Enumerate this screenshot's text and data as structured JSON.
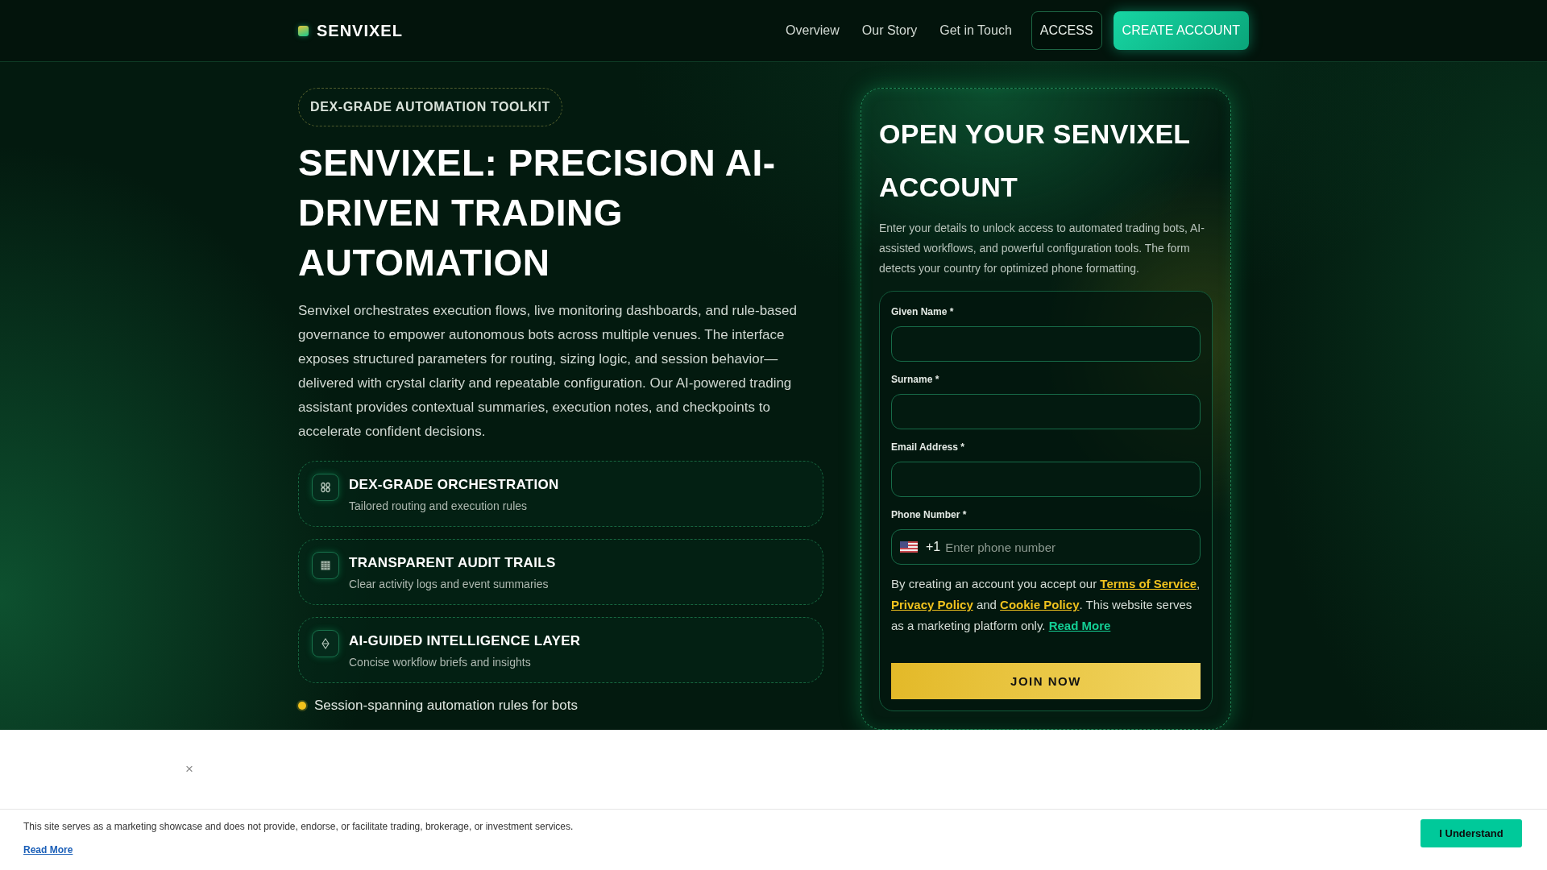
{
  "header": {
    "logo": "SENVIXEL",
    "nav": [
      {
        "label": "Overview",
        "kind": "link"
      },
      {
        "label": "Our Story",
        "kind": "link"
      },
      {
        "label": "Get in Touch",
        "kind": "link"
      },
      {
        "label": "ACCESS",
        "kind": "outline_button"
      },
      {
        "label": "CREATE ACCOUNT",
        "kind": "primary_button"
      }
    ]
  },
  "hero": {
    "badge": "DEX-GRADE AUTOMATION TOOLKIT",
    "title": "SENVIXEL: PRECISION AI-DRIVEN TRADING AUTOMATION",
    "description": "Senvixel orchestrates execution flows, live monitoring dashboards, and rule-based governance to empower autonomous bots across multiple venues. The interface exposes structured parameters for routing, sizing logic, and session behavior—delivered with crystal clarity and repeatable configuration. Our AI-powered trading assistant provides contextual summaries, execution notes, and checkpoints to accelerate confident decisions.",
    "features": [
      {
        "title": "DEX-GRADE ORCHESTRATION",
        "subtitle": "Tailored routing and execution rules"
      },
      {
        "title": "TRANSPARENT AUDIT TRAILS",
        "subtitle": "Clear activity logs and event summaries"
      },
      {
        "title": "AI-GUIDED INTELLIGENCE LAYER",
        "subtitle": "Concise workflow briefs and insights"
      }
    ],
    "highlight": "Session-spanning automation rules for bots"
  },
  "signup": {
    "title": "OPEN YOUR SENVIXEL ACCOUNT",
    "description": "Enter your details to unlock access to automated trading bots, AI-assisted workflows, and powerful configuration tools. The form detects your country for optimized phone formatting.",
    "fields": [
      {
        "label": "Given Name *",
        "kind": "text"
      },
      {
        "label": "Surname *",
        "kind": "text"
      },
      {
        "label": "Email Address *",
        "kind": "text"
      },
      {
        "label": "Phone Number *",
        "kind": "phone",
        "dial_code": "+1",
        "placeholder": "Enter phone number"
      }
    ],
    "consent": [
      {
        "kind": "text",
        "text": "By creating an account you accept our "
      },
      {
        "kind": "link",
        "text": "Terms of Service"
      },
      {
        "kind": "text",
        "text": ", "
      },
      {
        "kind": "link",
        "text": "Privacy Policy"
      },
      {
        "kind": "text",
        "text": " and "
      },
      {
        "kind": "link",
        "text": "Cookie Policy"
      },
      {
        "kind": "text",
        "text": ". This website serves as a marketing platform only. "
      },
      {
        "kind": "accent_link",
        "text": "Read More"
      }
    ],
    "submit": "JOIN NOW"
  },
  "overlay": {
    "close": "×"
  },
  "cookie_banner": {
    "text": "This site serves as a marketing showcase and does not provide, endorse, or facilitate trading, brokerage, or investment services.",
    "link": "Read More",
    "button": "I Understand"
  }
}
